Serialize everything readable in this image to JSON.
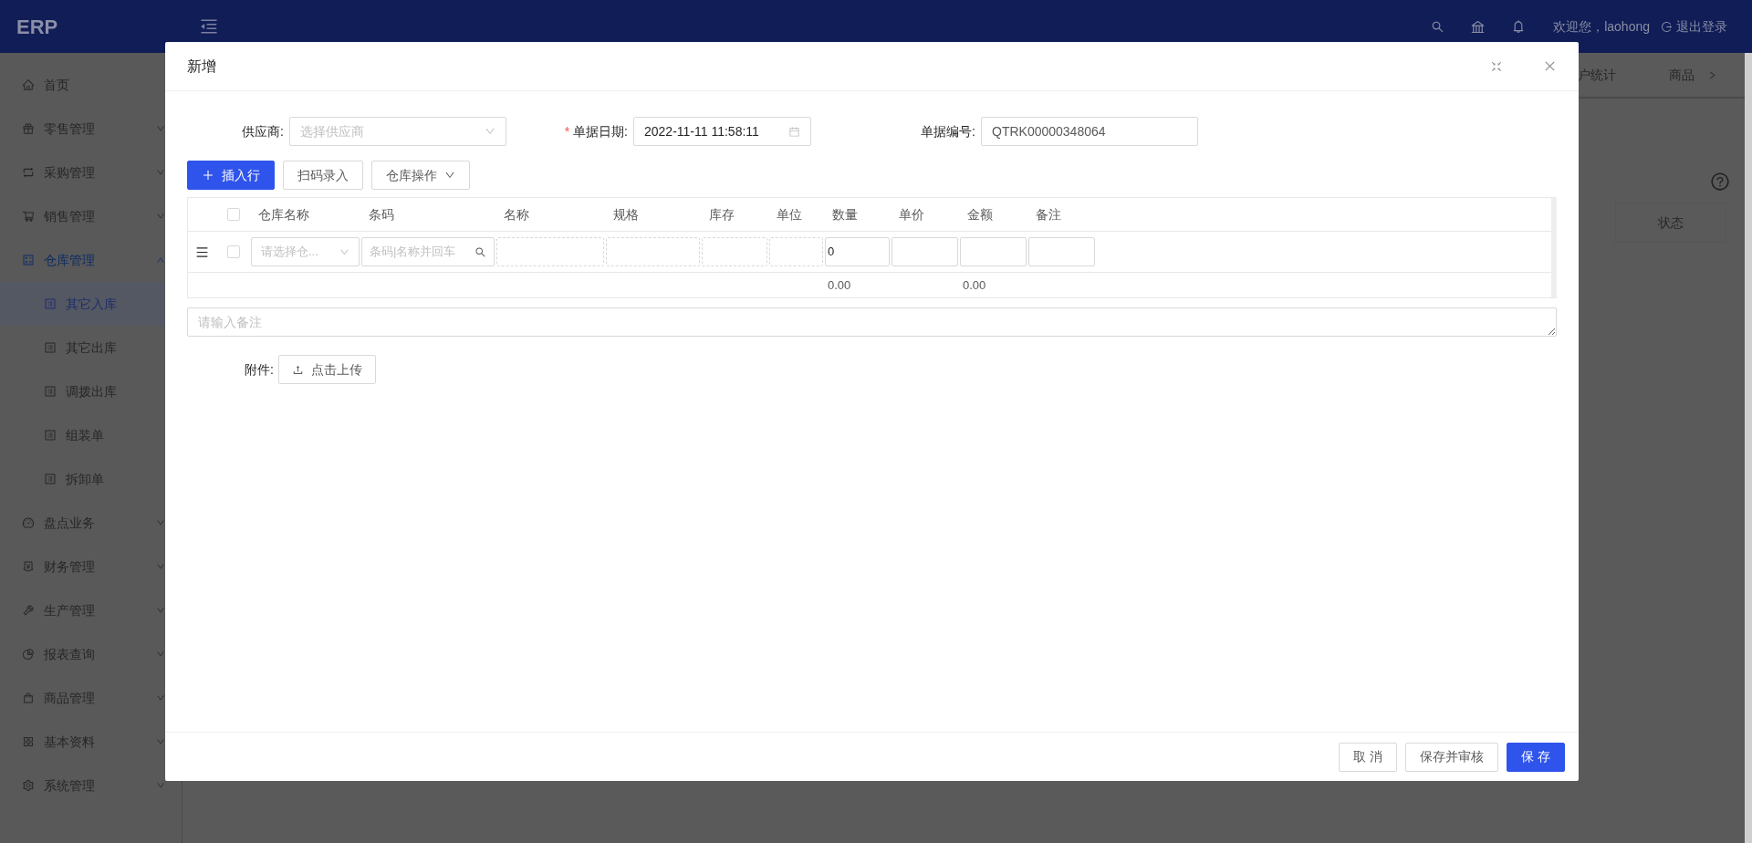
{
  "app": {
    "logo": "ERP",
    "welcome": "欢迎您，laohong",
    "logout": "退出登录"
  },
  "sidebar": {
    "items": [
      {
        "label": "首页",
        "selected": false
      },
      {
        "label": "零售管理",
        "selected": false,
        "expanded": false
      },
      {
        "label": "采购管理",
        "selected": false,
        "expanded": false
      },
      {
        "label": "销售管理",
        "selected": false,
        "expanded": false
      },
      {
        "label": "仓库管理",
        "selected": true,
        "expanded": true,
        "children": [
          {
            "label": "其它入库",
            "selected": true
          },
          {
            "label": "其它出库",
            "selected": false
          },
          {
            "label": "调拨出库",
            "selected": false
          },
          {
            "label": "组装单",
            "selected": false
          },
          {
            "label": "拆卸单",
            "selected": false
          }
        ]
      },
      {
        "label": "盘点业务",
        "selected": false,
        "expanded": false
      },
      {
        "label": "财务管理",
        "selected": false,
        "expanded": false
      },
      {
        "label": "生产管理",
        "selected": false,
        "expanded": false
      },
      {
        "label": "报表查询",
        "selected": false,
        "expanded": false
      },
      {
        "label": "商品管理",
        "selected": false,
        "expanded": false
      },
      {
        "label": "基本资料",
        "selected": false,
        "expanded": false
      },
      {
        "label": "系统管理",
        "selected": false,
        "expanded": false
      }
    ]
  },
  "background": {
    "tabs": [
      "户统计",
      "商品"
    ],
    "table_header": "状态"
  },
  "modal": {
    "title": "新增",
    "form": {
      "supplier": {
        "label": "供应商:",
        "placeholder": "选择供应商"
      },
      "date": {
        "label": "单据日期:",
        "required_mark": "*",
        "value": "2022-11-11 11:58:11"
      },
      "number": {
        "label": "单据编号:",
        "value": "QTRK00000348064"
      }
    },
    "toolbar": [
      {
        "label": "插入行",
        "kind": "primary"
      },
      {
        "label": "扫码录入",
        "kind": "default"
      },
      {
        "label": "仓库操作",
        "kind": "dropdown"
      }
    ],
    "table": {
      "all_checked": false,
      "columns": [
        "仓库名称",
        "条码",
        "名称",
        "规格",
        "库存",
        "单位",
        "数量",
        "单价",
        "金额",
        "备注"
      ],
      "rows": [
        {
          "checked": false,
          "warehouse": "请选择仓...",
          "barcode_placeholder": "条码|名称并回车",
          "quantity": "0"
        }
      ],
      "totals": {
        "quantity": "0.00",
        "amount": "0.00"
      }
    },
    "remark_placeholder": "请输入备注",
    "attachment": {
      "label": "附件:",
      "button": "点击上传"
    },
    "footer_buttons": [
      {
        "label": "取 消",
        "kind": "default"
      },
      {
        "label": "保存并审核",
        "kind": "default"
      },
      {
        "label": "保 存",
        "kind": "primary"
      }
    ]
  }
}
